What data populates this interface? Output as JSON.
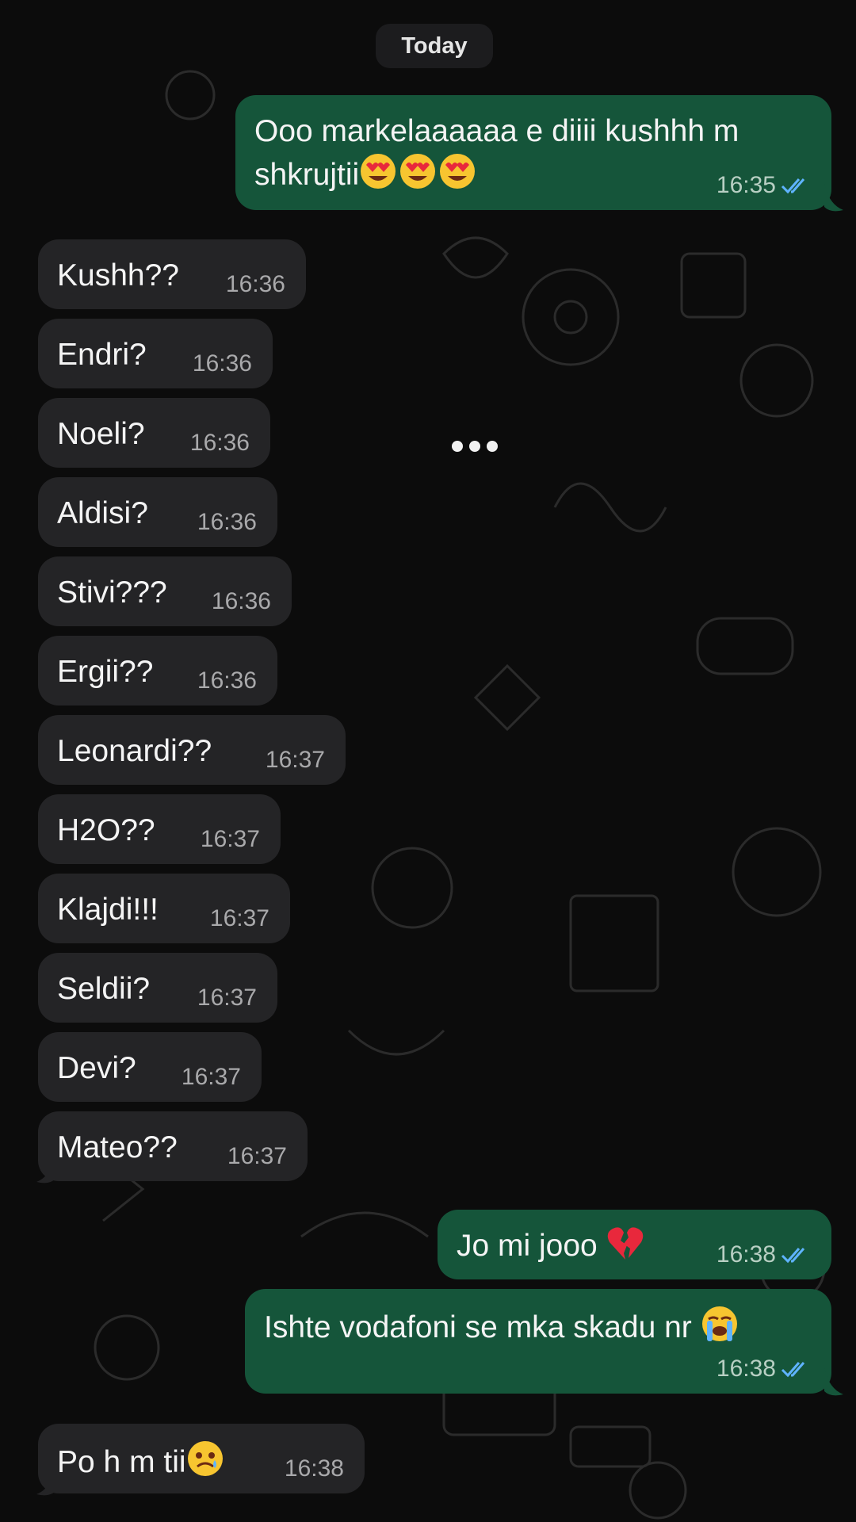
{
  "date_chip": "Today",
  "colors": {
    "background": "#0c0c0c",
    "incoming_bubble": "#242426",
    "outgoing_bubble": "#15553a",
    "read_ticks": "#5fb3ff",
    "time_text": "#a9a9ab"
  },
  "messages": [
    {
      "dir": "out",
      "text": "Ooo markelaaaaaa e diiii kushhh m shkrujtii",
      "emoji": "heart-eyes-face x3",
      "time": "16:35",
      "status": "read"
    },
    {
      "dir": "in",
      "text": "Kushh??",
      "time": "16:36"
    },
    {
      "dir": "in",
      "text": "Endri?",
      "time": "16:36"
    },
    {
      "dir": "in",
      "text": "Noeli?",
      "time": "16:36"
    },
    {
      "dir": "in",
      "text": "Aldisi?",
      "time": "16:36"
    },
    {
      "dir": "in",
      "text": "Stivi???",
      "time": "16:36"
    },
    {
      "dir": "in",
      "text": "Ergii??",
      "time": "16:36"
    },
    {
      "dir": "in",
      "text": "Leonardi??",
      "time": "16:37"
    },
    {
      "dir": "in",
      "text": "H2O??",
      "time": "16:37"
    },
    {
      "dir": "in",
      "text": "Klajdi!!!",
      "time": "16:37"
    },
    {
      "dir": "in",
      "text": "Seldii?",
      "time": "16:37"
    },
    {
      "dir": "in",
      "text": "Devi?",
      "time": "16:37"
    },
    {
      "dir": "in",
      "text": "Mateo??",
      "time": "16:37"
    },
    {
      "dir": "out",
      "text": "Jo mi jooo",
      "emoji": "broken-heart",
      "time": "16:38",
      "status": "read"
    },
    {
      "dir": "out",
      "text": "Ishte vodafoni se mka skadu nr",
      "emoji": "loudly-crying-face",
      "time": "16:38",
      "status": "read"
    },
    {
      "dir": "in",
      "text": "Po h m tii",
      "emoji": "face-holding-back-tears",
      "time": "16:38"
    }
  ]
}
